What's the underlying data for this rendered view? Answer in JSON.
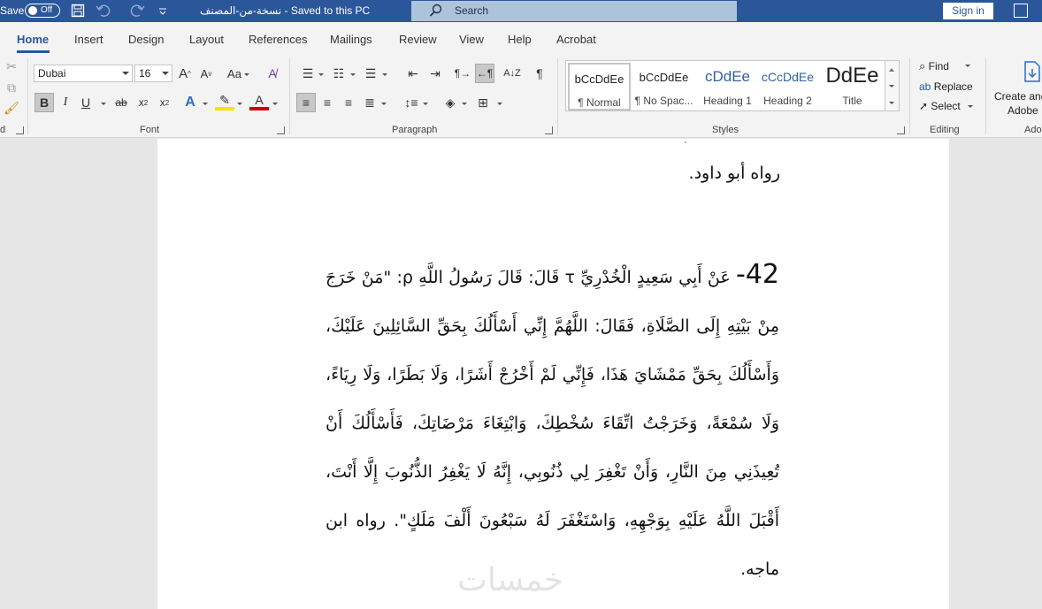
{
  "titlebar": {
    "autosave_label": "Save",
    "toggle_state": "Off",
    "doc_title": "نسخة-من-المصنف  -  Saved to this PC",
    "search_placeholder": "Search",
    "signin_label": "Sign in"
  },
  "tabs": [
    "Home",
    "Insert",
    "Design",
    "Layout",
    "References",
    "Mailings",
    "Review",
    "View",
    "Help",
    "Acrobat"
  ],
  "ribbon": {
    "font": {
      "group_label": "Font",
      "font_name": "Dubai",
      "font_size": "16"
    },
    "paragraph": {
      "group_label": "Paragraph"
    },
    "styles": {
      "group_label": "Styles",
      "items": [
        {
          "preview": "bCcDdEe",
          "name": "¶ Normal"
        },
        {
          "preview": "bCcDdEe",
          "name": "¶ No Spac..."
        },
        {
          "preview": "cDdEe",
          "name": "Heading 1"
        },
        {
          "preview": "cCcDdEe",
          "name": "Heading 2"
        },
        {
          "preview": "DdEe",
          "name": "Title"
        }
      ]
    },
    "editing": {
      "group_label": "Editing",
      "find_label": "Find",
      "replace_label": "Replace",
      "select_label": "Select"
    },
    "adobe": {
      "create_label_1": "Create and",
      "create_label_2": "Adobe",
      "group_label": "Ado"
    },
    "clipboard_group_label": "d"
  },
  "document": {
    "line_top": "رواه أبو داود.",
    "hadith_number": "42-",
    "hadith_text": " عَنْ أَبِي سَعِيدٍ الْخُدْرِيِّ τ قَالَ: قَالَ رَسُولُ اللَّهِ ρ: \"مَنْ خَرَجَ مِنْ بَيْتِهِ إِلَى الصَّلَاةِ، فَقَالَ: اللَّهُمَّ إِنِّي أَسْأَلُكَ بِحَقِّ السَّائِلِينَ عَلَيْكَ، وَأَسْأَلُكَ بِحَقِّ مَمْشَايَ هَذَا، فَإِنِّي لَمْ أَخْرُجْ أَشَرًا، وَلَا بَطَرًا، وَلَا رِيَاءً، وَلَا سُمْعَةً، وَخَرَجْتُ اتِّقَاءَ سُخْطِكَ، وَابْتِغَاءَ مَرْضَاتِكَ، فَأَسْأَلُكَ أَنْ تُعِيذَنِي مِنَ النَّارِ، وَأَنْ تَغْفِرَ لِي ذُنُوبِي، إِنَّهُ لَا يَغْفِرُ الذُّنُوبَ إِلَّا أَنْتَ، أَقْبَلَ اللَّهُ عَلَيْهِ بِوَجْهِهِ، وَاسْتَغْفَرَ لَهُ سَبْعُونَ أَلْفَ مَلَكٍ\". رواه ابن ماجه.",
    "watermark": "خمسات"
  },
  "colors": {
    "titlebar": "#2b579a",
    "ribbon": "#f3f3f3",
    "search": "#adc2dc",
    "page": "#ffffff",
    "canvas": "#e6e6e6"
  }
}
